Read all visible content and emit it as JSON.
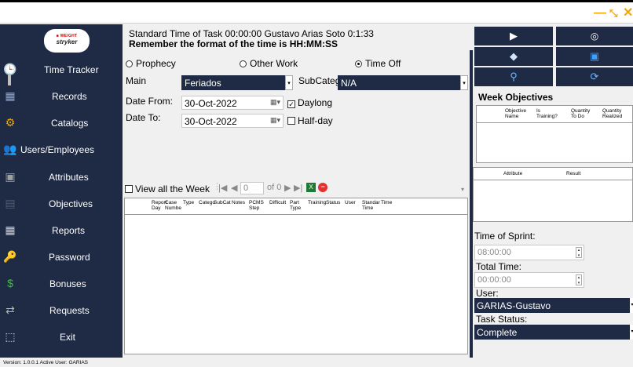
{
  "window": {
    "minimize_glyph": "—",
    "restore_glyph": "⤡",
    "close_glyph": "✕"
  },
  "logo": {
    "brand_top": "■ WEIGHT",
    "brand_main": "stryker"
  },
  "sidebar": {
    "items": [
      {
        "label": "Time Tracker",
        "icon": "🕒",
        "color": "#f5a800"
      },
      {
        "label": "Records",
        "icon": "▦",
        "color": "#8fa4c8"
      },
      {
        "label": "Catalogs",
        "icon": "⚙",
        "color": "#f5a800"
      },
      {
        "label": "Users/Employees",
        "icon": "👥",
        "color": "#7cc47c"
      },
      {
        "label": "Attributes",
        "icon": "▣",
        "color": "#a0a0a0"
      },
      {
        "label": "Objectives",
        "icon": "▤",
        "color": "#5a5a5a"
      },
      {
        "label": "Reports",
        "icon": "▦",
        "color": "#cfcfcf"
      },
      {
        "label": "Password",
        "icon": "🔑",
        "color": "#f5a800"
      },
      {
        "label": "Bonuses",
        "icon": "$",
        "color": "#39c339"
      },
      {
        "label": "Requests",
        "icon": "⇄",
        "color": "#9bc29b"
      },
      {
        "label": "Exit",
        "icon": "⬚",
        "color": "#cfcfcf"
      }
    ]
  },
  "header": {
    "line1": "Standard Time of Task   00:00:00   Gustavo  Arias Soto   0:1:33",
    "line2": "Remember the format of the time is HH:MM:SS"
  },
  "task_type": {
    "options": [
      "Prophecy",
      "Other Work",
      "Time Off"
    ],
    "selected": "Time Off"
  },
  "form": {
    "main_label": "Main",
    "main_value": "Feriados",
    "subcat_label": "SubCatego",
    "subcat_value": "N/A",
    "date_from_label": "Date From:",
    "date_from_value": "30-Oct-2022",
    "date_to_label": "Date To:",
    "date_to_value": "30-Oct-2022",
    "daylong_label": "Daylong",
    "halfday_label": "Half-day"
  },
  "toolbar": {
    "view_all_week": "View all the Week",
    "page_value": "0",
    "page_of": "of 0"
  },
  "records_table": {
    "columns": [
      "Report Day",
      "Case Numbe",
      "Type",
      "Catego",
      "SubCat",
      "Notes",
      "PCMS Step",
      "Difficult",
      "Part Type",
      "Training",
      "Status",
      "User",
      "Standar Time",
      "Time"
    ]
  },
  "right_panel": {
    "week_objectives_title": "Week Objectives",
    "objectives_columns": [
      "Objective Name",
      "Is Training?",
      "Quantity To Do",
      "Quantity Realized"
    ],
    "attributes_columns": [
      "Attribute",
      "Result"
    ],
    "time_of_sprint_label": "Time of Sprint:",
    "time_of_sprint_value": "08:00:00",
    "total_time_label": "Total Time:",
    "total_time_value": "00:00:00",
    "user_label": "User:",
    "user_value": "GARIAS-Gustavo",
    "task_status_label": "Task Status:",
    "task_status_value": "Complete"
  },
  "status_bar": {
    "text": "Version: 1.0.0.1  Active User: GARIAS"
  }
}
